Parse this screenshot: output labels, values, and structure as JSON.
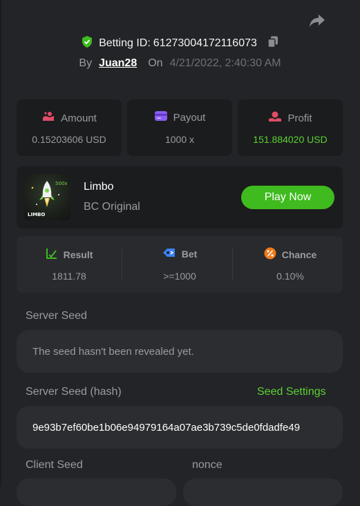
{
  "header": {
    "betting_id_label": "Betting ID:",
    "betting_id": "61273004172116073",
    "by_label": "By",
    "username": "Juan28",
    "on_label": "On",
    "datetime": "4/21/2022, 2:40:30 AM"
  },
  "stats": {
    "amount": {
      "label": "Amount",
      "value": "0.15203606 USD"
    },
    "payout": {
      "label": "Payout",
      "value": "1000 x"
    },
    "profit": {
      "label": "Profit",
      "value": "151.884020 USD"
    }
  },
  "game": {
    "name": "Limbo",
    "subtitle": "BC Original",
    "thumb_text": "LIMBO",
    "thumb_multiplier": "500x",
    "play_label": "Play Now"
  },
  "result": {
    "result": {
      "label": "Result",
      "value": "1811.78"
    },
    "bet": {
      "label": "Bet",
      "value": ">=1000"
    },
    "chance": {
      "label": "Chance",
      "value": "0.10%"
    }
  },
  "seeds": {
    "server_seed_label": "Server Seed",
    "server_seed_value": "The seed hasn't been revealed yet.",
    "server_hash_label": "Server Seed (hash)",
    "seed_settings_label": "Seed Settings",
    "server_hash_value": "9e93b7ef60be1b06e94979164a07ae3b739c5de0fdadfe49",
    "client_seed_label": "Client Seed",
    "nonce_label": "nonce"
  },
  "colors": {
    "accent_green": "#3fbb1f",
    "profit_green": "#5cd133",
    "background": "#232427",
    "card": "#1b1c1e"
  }
}
